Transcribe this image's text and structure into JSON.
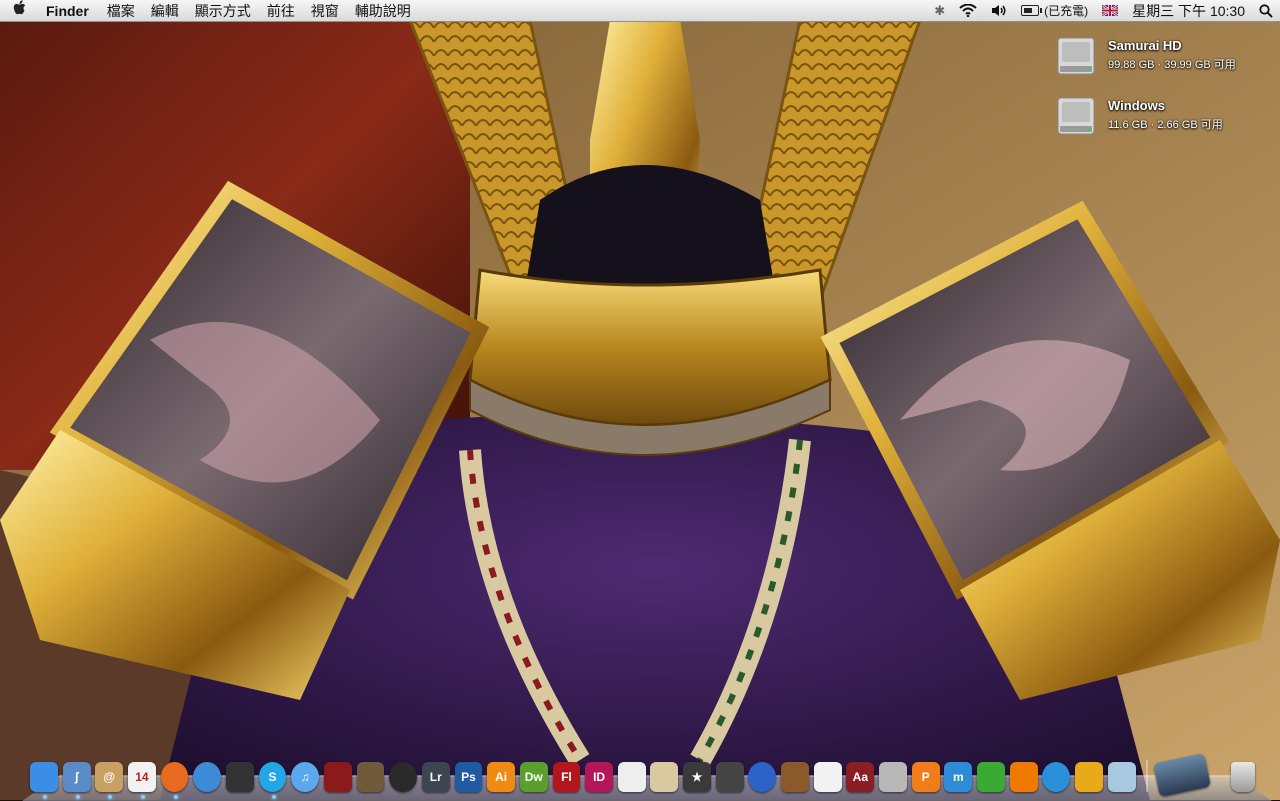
{
  "menubar": {
    "app_name": "Finder",
    "menus": [
      "檔案",
      "編輯",
      "顯示方式",
      "前往",
      "視窗",
      "輔助說明"
    ],
    "battery_status": "(已充電)",
    "clock": "星期三 下午 10:30"
  },
  "desktop": {
    "disks": [
      {
        "name": "Samurai HD",
        "info": "99.88 GB · 39.99 GB 可用"
      },
      {
        "name": "Windows",
        "info": "11.6 GB · 2.66 GB 可用"
      }
    ]
  },
  "dock": {
    "apps": [
      {
        "name": "Finder",
        "icon": "finder-icon",
        "color": "#3a8ee6",
        "label": ""
      },
      {
        "name": "Script",
        "icon": "script-icon",
        "color": "#5b8ac8",
        "label": "ʃ"
      },
      {
        "name": "Address Book",
        "icon": "address-book-icon",
        "color": "#c9a064",
        "label": "@"
      },
      {
        "name": "iCal",
        "icon": "ical-icon",
        "color": "#f2f2f2",
        "label": "14"
      },
      {
        "name": "Firefox",
        "icon": "firefox-icon",
        "color": "#e66a1f",
        "label": ""
      },
      {
        "name": "Safari",
        "icon": "safari-icon",
        "color": "#3d8bd6",
        "label": ""
      },
      {
        "name": "Ninja",
        "icon": "ninja-icon",
        "color": "#333333",
        "label": ""
      },
      {
        "name": "Skype",
        "icon": "skype-icon",
        "color": "#21a6e8",
        "label": "S"
      },
      {
        "name": "iTunes",
        "icon": "itunes-icon",
        "color": "#5aa8ee",
        "label": "♫"
      },
      {
        "name": "iDVD",
        "icon": "idvd-icon",
        "color": "#8b1b1b",
        "label": ""
      },
      {
        "name": "iPhoto",
        "icon": "iphoto-icon",
        "color": "#6f5a3a",
        "label": ""
      },
      {
        "name": "Aperture",
        "icon": "aperture-icon",
        "color": "#2a2a2a",
        "label": ""
      },
      {
        "name": "Lightroom",
        "icon": "lightroom-icon",
        "color": "#3c4550",
        "label": "Lr"
      },
      {
        "name": "Photoshop",
        "icon": "photoshop-icon",
        "color": "#1f5aa3",
        "label": "Ps"
      },
      {
        "name": "Illustrator",
        "icon": "illustrator-icon",
        "color": "#f08a12",
        "label": "Ai"
      },
      {
        "name": "Dreamweaver",
        "icon": "dreamweaver-icon",
        "color": "#5a9e2c",
        "label": "Dw"
      },
      {
        "name": "Flash",
        "icon": "flash-icon",
        "color": "#b3161c",
        "label": "Fl"
      },
      {
        "name": "InDesign",
        "icon": "indesign-icon",
        "color": "#b3175a",
        "label": "ID"
      },
      {
        "name": "Acrobat",
        "icon": "acrobat-icon",
        "color": "#eeeeee",
        "label": ""
      },
      {
        "name": "Preview",
        "icon": "preview-icon",
        "color": "#d9c9a0",
        "label": ""
      },
      {
        "name": "iMovie",
        "icon": "imovie-icon",
        "color": "#3a3a3a",
        "label": "★"
      },
      {
        "name": "Final Cut",
        "icon": "final-cut-icon",
        "color": "#444444",
        "label": ""
      },
      {
        "name": "DVD Player",
        "icon": "dvd-player-icon",
        "color": "#2b64c6",
        "label": ""
      },
      {
        "name": "GarageBand",
        "icon": "garageband-icon",
        "color": "#8b5a2b",
        "label": ""
      },
      {
        "name": "TextEdit",
        "icon": "textedit-icon",
        "color": "#f2f2f2",
        "label": ""
      },
      {
        "name": "Dictionary",
        "icon": "dictionary-icon",
        "color": "#8b1e24",
        "label": "Aa"
      },
      {
        "name": "Calculator",
        "icon": "calculator-icon",
        "color": "#b8b8b8",
        "label": ""
      },
      {
        "name": "Pages",
        "icon": "pages-icon",
        "color": "#f07c1a",
        "label": "P"
      },
      {
        "name": "Keynote",
        "icon": "keynote-icon",
        "color": "#2d8bd8",
        "label": "m"
      },
      {
        "name": "Numbers",
        "icon": "numbers-icon",
        "color": "#3aaa35",
        "label": ""
      },
      {
        "name": "VLC",
        "icon": "vlc-icon",
        "color": "#f07a00",
        "label": ""
      },
      {
        "name": "QuickTime",
        "icon": "quicktime-icon",
        "color": "#2b90d9",
        "label": ""
      },
      {
        "name": "Front Row",
        "icon": "front-row-icon",
        "color": "#e8a91a",
        "label": ""
      },
      {
        "name": "Cube",
        "icon": "cube-icon",
        "color": "#a8c8e0",
        "label": ""
      }
    ],
    "stacks": [
      {
        "name": "Downloads",
        "icon": "stack-icon"
      },
      {
        "name": "Trash",
        "icon": "trash-icon"
      }
    ]
  },
  "colors": {
    "menubar": "#e8e8e8",
    "wallpaper_dark": "#1a120a",
    "gold": "#d4a52a",
    "purple_cloth": "#3a1f55"
  }
}
